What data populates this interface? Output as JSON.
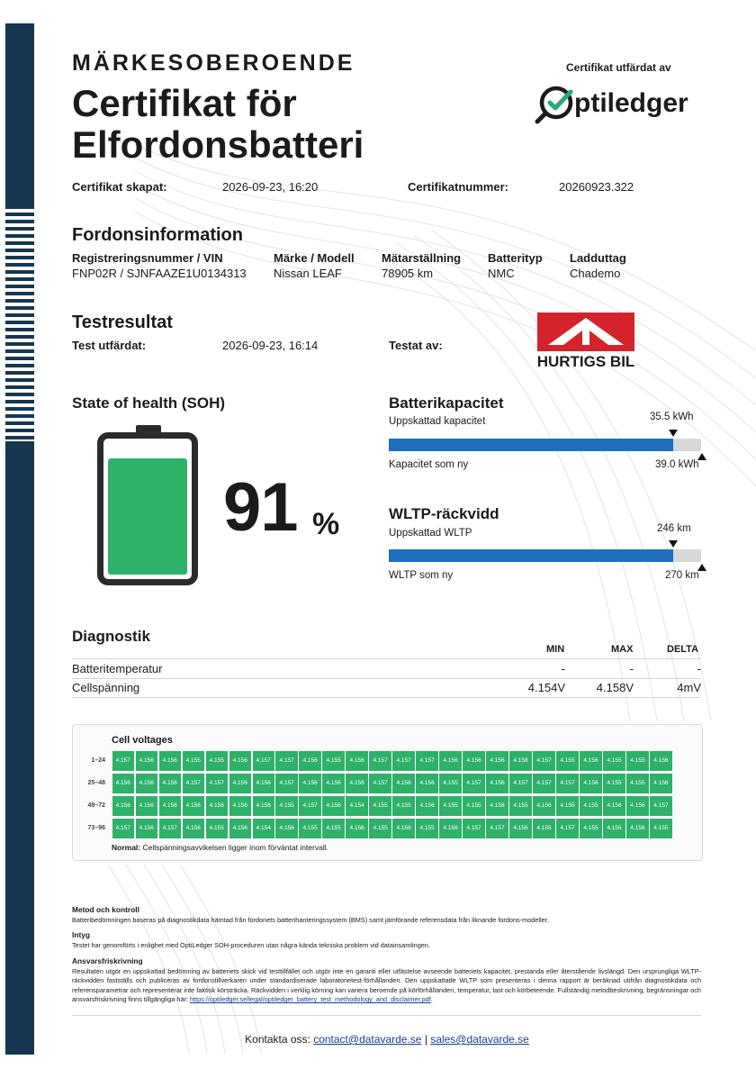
{
  "header": {
    "kicker": "MÄRKESOBEROENDE",
    "title_line1": "Certifikat för",
    "title_line2": "Elfordonsbatteri",
    "issued_by_label": "Certifikat utfärdat av",
    "issuer_logo_text": "ptiledger"
  },
  "meta": {
    "created_label": "Certifikat skapat:",
    "created_value": "2026-09-23, 16:20",
    "number_label": "Certifikatnummer:",
    "number_value": "20260923.322"
  },
  "vehicle": {
    "heading": "Fordonsinformation",
    "columns": [
      {
        "label": "Registreringsnummer / VIN",
        "value": "FNP02R / SJNFAAZE1U0134313"
      },
      {
        "label": "Märke / Modell",
        "value": "Nissan LEAF"
      },
      {
        "label": "Mätarställning",
        "value": "78905 km"
      },
      {
        "label": "Batterityp",
        "value": "NMC"
      },
      {
        "label": "Ladduttag",
        "value": "Chademo"
      }
    ]
  },
  "test": {
    "heading": "Testresultat",
    "issued_label": "Test utfärdat:",
    "issued_value": "2026-09-23, 16:14",
    "tested_by_label": "Testat av:",
    "tester_logo_text": "HURTIGS BIL"
  },
  "soh": {
    "heading": "State of health (SOH)",
    "value": "91",
    "unit": "%",
    "fill_fraction": 0.91,
    "fill_color": "#2eb169"
  },
  "capacity": {
    "heading": "Batterikapacitet",
    "estimated_label": "Uppskattad kapacitet",
    "estimated_value": "35.5 kWh",
    "new_label": "Kapacitet som ny",
    "new_value": "39.0 kWh",
    "fraction": 0.91
  },
  "wltp": {
    "heading": "WLTP-räckvidd",
    "estimated_label": "Uppskattad WLTP",
    "estimated_value": "246 km",
    "new_label": "WLTP som ny",
    "new_value": "270 km",
    "fraction": 0.911
  },
  "diagnostics": {
    "heading": "Diagnostik",
    "col_min": "MIN",
    "col_max": "MAX",
    "col_delta": "DELTA",
    "rows": [
      {
        "label": "Batteritemperatur",
        "min": "-",
        "max": "-",
        "delta": "-"
      },
      {
        "label": "Cellspänning",
        "min": "4.154V",
        "max": "4.158V",
        "delta": "4mV"
      }
    ]
  },
  "cells": {
    "title": "Cell voltages",
    "cell_color": "#2eb169",
    "rows": [
      {
        "label": "1–24",
        "values": [
          "4.157",
          "4.156",
          "4.156",
          "4.155",
          "4.155",
          "4.156",
          "4.157",
          "4.157",
          "4.156",
          "4.155",
          "4.156",
          "4.157",
          "4.157",
          "4.157",
          "4.156",
          "4.156",
          "4.156",
          "4.158",
          "4.157",
          "4.155",
          "4.156",
          "4.155",
          "4.155",
          "4.156"
        ]
      },
      {
        "label": "25–48",
        "values": [
          "4.156",
          "4.156",
          "4.156",
          "4.157",
          "4.157",
          "4.156",
          "4.156",
          "4.157",
          "4.156",
          "4.156",
          "4.156",
          "4.157",
          "4.156",
          "4.156",
          "4.155",
          "4.157",
          "4.156",
          "4.157",
          "4.157",
          "4.157",
          "4.156",
          "4.155",
          "4.155",
          "4.156"
        ]
      },
      {
        "label": "49–72",
        "values": [
          "4.156",
          "4.156",
          "4.156",
          "4.156",
          "4.156",
          "4.156",
          "4.156",
          "4.155",
          "4.157",
          "4.156",
          "4.154",
          "4.155",
          "4.155",
          "4.156",
          "4.155",
          "4.155",
          "4.158",
          "4.155",
          "4.156",
          "4.155",
          "4.155",
          "4.156",
          "4.156",
          "4.157"
        ]
      },
      {
        "label": "73–96",
        "values": [
          "4.157",
          "4.156",
          "4.157",
          "4.156",
          "4.155",
          "4.156",
          "4.154",
          "4.156",
          "4.155",
          "4.155",
          "4.156",
          "4.155",
          "4.156",
          "4.155",
          "4.156",
          "4.157",
          "4.157",
          "4.156",
          "4.155",
          "4.157",
          "4.155",
          "4.156",
          "4.156",
          "4.155"
        ]
      }
    ],
    "note_bold": "Normal:",
    "note_text": " Cellspänningsavvikelsen ligger inom förväntat intervall."
  },
  "footer": {
    "method_heading": "Metod och kontroll",
    "method_text": "Batteribedömningen baseras på diagnostikdata hämtad från fordonets batterihanteringssystem (BMS) samt jämförande referensdata från liknande fordons-modeller.",
    "attest_heading": "Intyg",
    "attest_text": "Testet har genomförts i enlighet med OptiLedger SOH-proceduren utan några kända tekniska problem vid datainsamlingen.",
    "disclaimer_heading": "Ansvarsfriskrivning",
    "disclaimer_text": "Resultaten utgör en uppskattad bedömning av batteriets skick vid testtillfället och utgör inte en garanti eller utfästelse avseende batteriets kapacitet, prestanda eller återstående livslängd. Den ursprungliga WLTP-räckvidden fastställs och publiceras av fordonstillverkaren under standardiserade laboratorietest-förhållanden. Den uppskattade WLTP som presenteras i denna rapport är beräknad utifrån diagnostikdata och referensparametrar och representerar inte faktisk körsträcka. Räckvidden i verklig körning kan variera beroende på körförhållanden, temperatur, last och körbeteende. Fullständig metodbeskrivning, begränsningar och ansvarsfriskrivning finns tillgängliga här: ",
    "disclaimer_link": "https://optiledger.se/legal/optiledger_battery_test_methodology_and_disclaimer.pdf",
    "disclaimer_end": ".",
    "contact_label": "Kontakta oss:",
    "contact_email": "contact@datavarde.se",
    "separator": "|",
    "sales_email": "sales@datavarde.se"
  }
}
